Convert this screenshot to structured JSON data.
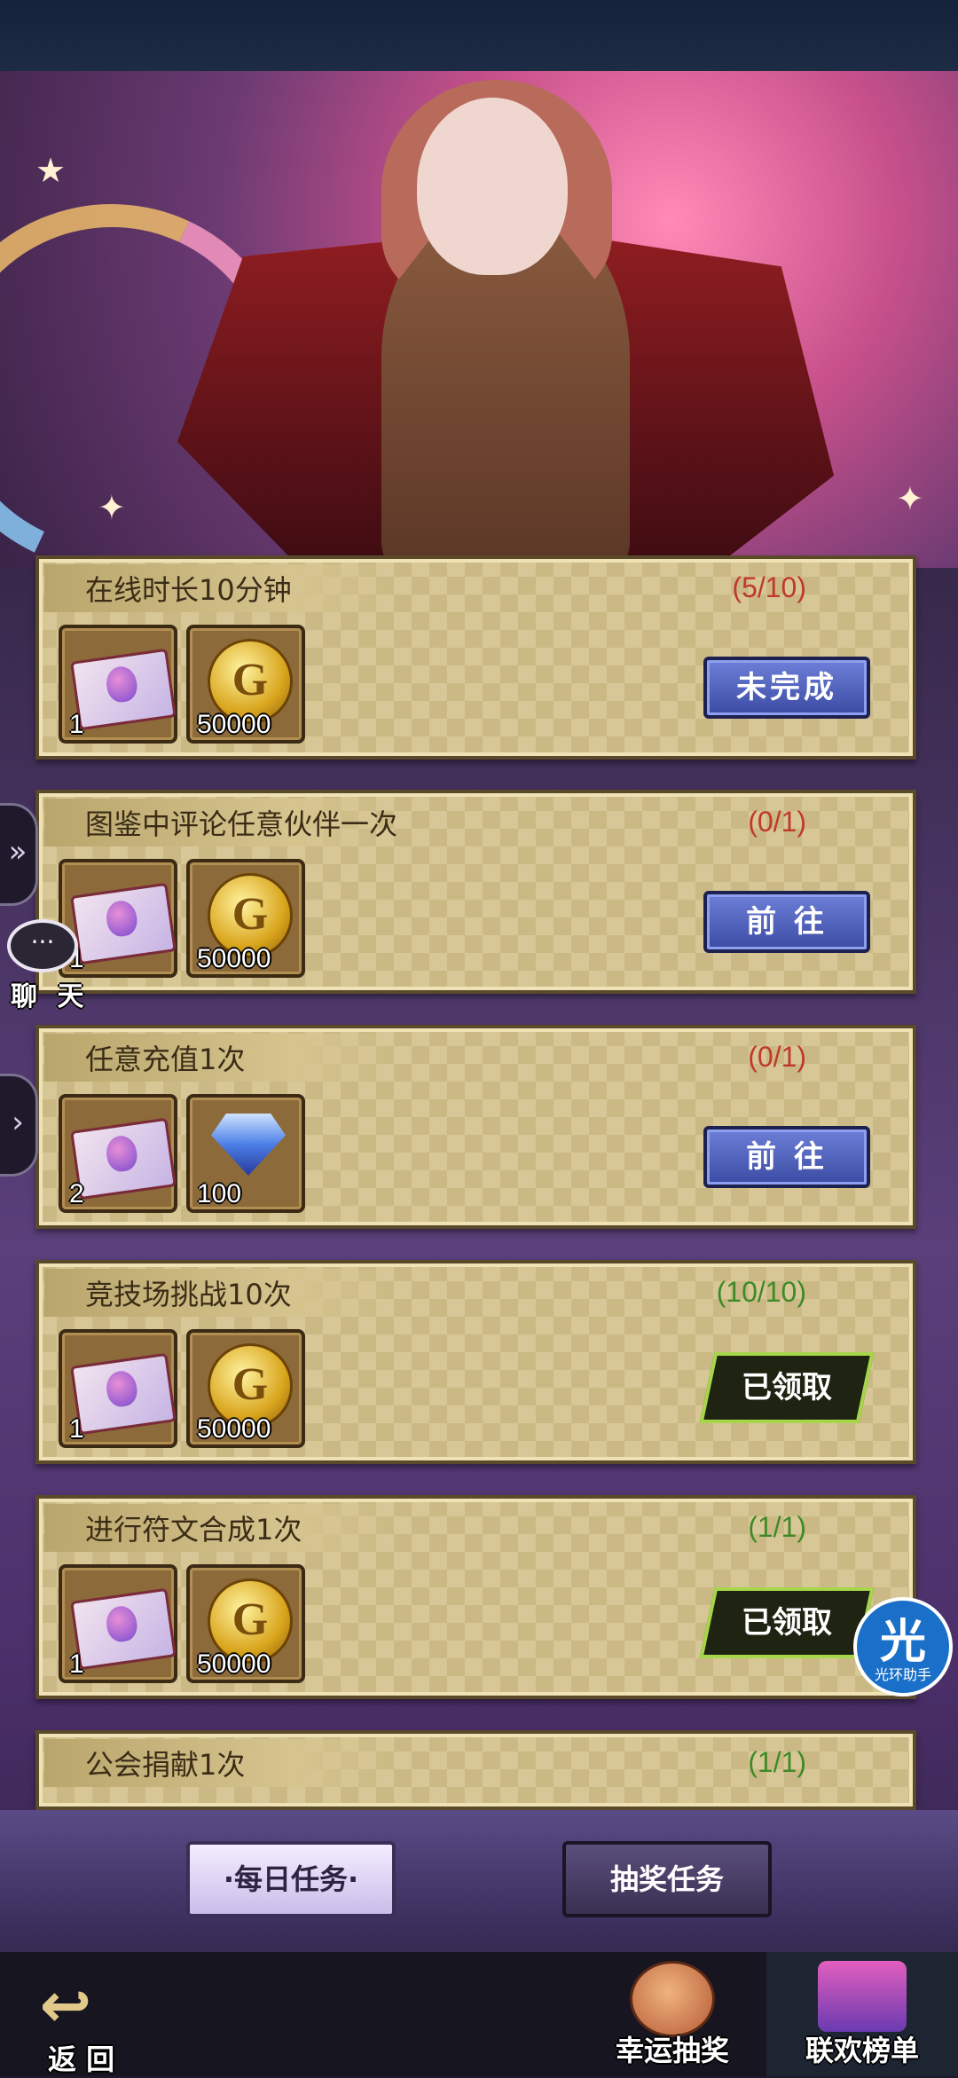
{
  "tasks": [
    {
      "title": "在线时长10分钟",
      "progress": "(5/10)",
      "status": "red",
      "rewards": [
        {
          "icon": "ticket-icon",
          "count": "1"
        },
        {
          "icon": "gold-coin-icon",
          "count": "50000"
        }
      ],
      "action": {
        "type": "button",
        "label": "未完成"
      }
    },
    {
      "title": "图鉴中评论任意伙伴一次",
      "progress": "(0/1)",
      "status": "red",
      "rewards": [
        {
          "icon": "ticket-icon",
          "count": "1"
        },
        {
          "icon": "gold-coin-icon",
          "count": "50000"
        }
      ],
      "action": {
        "type": "button",
        "label": "前 往"
      }
    },
    {
      "title": "任意充值1次",
      "progress": "(0/1)",
      "status": "red",
      "rewards": [
        {
          "icon": "ticket-icon",
          "count": "2"
        },
        {
          "icon": "diamond-icon",
          "count": "100"
        }
      ],
      "action": {
        "type": "button",
        "label": "前 往"
      }
    },
    {
      "title": "竞技场挑战10次",
      "progress": "(10/10)",
      "status": "green",
      "rewards": [
        {
          "icon": "ticket-icon",
          "count": "1"
        },
        {
          "icon": "gold-coin-icon",
          "count": "50000"
        }
      ],
      "action": {
        "type": "stamp",
        "label": "已领取"
      }
    },
    {
      "title": "进行符文合成1次",
      "progress": "(1/1)",
      "status": "green",
      "rewards": [
        {
          "icon": "ticket-icon",
          "count": "1"
        },
        {
          "icon": "gold-coin-icon",
          "count": "50000"
        }
      ],
      "action": {
        "type": "stamp",
        "label": "已领取"
      }
    },
    {
      "title": "公会捐献1次",
      "progress": "(1/1)",
      "status": "green"
    }
  ],
  "chat": {
    "label": "聊 天",
    "bubble": "···"
  },
  "helper": {
    "glyph": "光",
    "label": "光环助手"
  },
  "tabs": {
    "daily": "·每日任务·",
    "lottery": "抽奖任务"
  },
  "nav": {
    "back": "返 回",
    "lucky": "幸运抽奖",
    "ranking": "联欢榜单"
  },
  "colors": {
    "progress_red": "#c0392b",
    "progress_green": "#3f8a27",
    "button_blue": "#3b4ba3"
  }
}
